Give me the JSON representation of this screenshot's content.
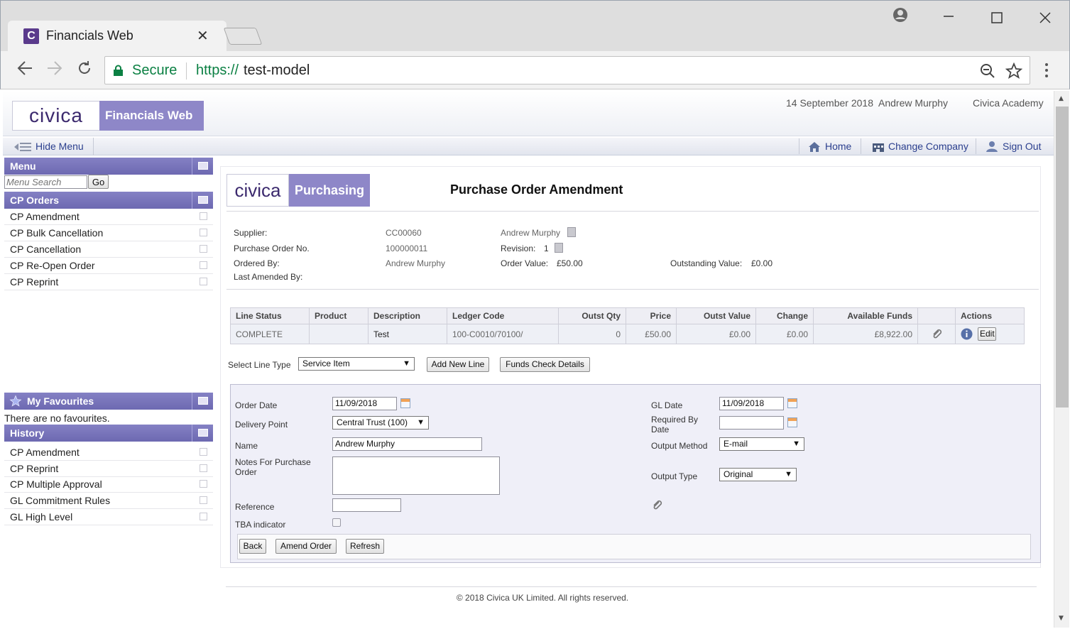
{
  "browser": {
    "tab_title": "Financials Web",
    "tab_icon": "C",
    "tab_close": "✕",
    "secure_label": "Secure",
    "url_scheme": "https://",
    "url_host": "test-model"
  },
  "header": {
    "logo_civica": "civica",
    "logo_product": "Financials Web",
    "date": "14 September 2018",
    "user": "Andrew Murphy",
    "organisation": "Civica Academy"
  },
  "menubar": {
    "hide_menu": "Hide Menu",
    "home": "Home",
    "change_company": "Change Company",
    "sign_out": "Sign Out"
  },
  "sidebar": {
    "menu_title": "Menu",
    "search_placeholder": "Menu Search",
    "go_label": "Go",
    "cp_orders_title": "CP Orders",
    "cp_orders_items": [
      "CP Amendment",
      "CP Bulk Cancellation",
      "CP Cancellation",
      "CP Re-Open Order",
      "CP Reprint"
    ],
    "favourites_title": "My Favourites",
    "favourites_empty": "There are no favourites.",
    "history_title": "History",
    "history_items": [
      "CP Amendment",
      "CP Reprint",
      "CP Multiple Approval",
      "GL Commitment Rules",
      "GL High Level"
    ]
  },
  "content": {
    "module_logo_civica": "civica",
    "module_logo_name": "Purchasing",
    "page_title": "Purchase Order Amendment",
    "summary": {
      "supplier_label": "Supplier:",
      "supplier_code": "CC00060",
      "supplier_name": "Andrew Murphy",
      "po_label": "Purchase Order No.",
      "po_number": "100000011",
      "revision_label": "Revision:",
      "revision_value": "1",
      "ordered_by_label": "Ordered By:",
      "ordered_by": "Andrew Murphy",
      "order_value_label": "Order Value:",
      "order_value": "£50.00",
      "outstanding_label": "Outstanding Value:",
      "outstanding_value": "£0.00",
      "last_amended_label": "Last Amended By:"
    },
    "lines_table": {
      "headers": [
        "Line Status",
        "Product",
        "Description",
        "Ledger Code",
        "Outst Qty",
        "Price",
        "Outst Value",
        "Change",
        "Available Funds",
        "",
        "Actions"
      ],
      "rows": [
        [
          "COMPLETE",
          "",
          "Test",
          "100-C0010/70100/",
          "0",
          "£50.00",
          "£0.00",
          "£0.00",
          "£8,922.00"
        ]
      ],
      "edit_label": "Edit"
    },
    "line_type": {
      "label": "Select Line Type",
      "value": "Service Item",
      "add_button": "Add New Line",
      "funds_button": "Funds Check Details"
    },
    "form": {
      "order_date_label": "Order Date",
      "order_date": "11/09/2018",
      "delivery_label": "Delivery Point",
      "delivery_value": "Central Trust (100)",
      "name_label": "Name",
      "name_value": "Andrew Murphy",
      "notes_label_1": "Notes For Purchase",
      "notes_label_2": "Order",
      "notes_value": "",
      "reference_label": "Reference",
      "reference_value": "",
      "tba_label": "TBA indicator",
      "gl_date_label": "GL Date",
      "gl_date": "11/09/2018",
      "required_label_1": "Required By",
      "required_label_2": "Date",
      "required_value": "",
      "output_method_label": "Output Method",
      "output_method": "E-mail",
      "output_type_label": "Output Type",
      "output_type": "Original",
      "back_button": "Back",
      "amend_button": "Amend Order",
      "refresh_button": "Refresh"
    },
    "footer": "© 2018 Civica UK Limited. All rights reserved."
  },
  "colors": {
    "accent_purple": "#8e87c8",
    "panel_header": "#6d69b1",
    "link_blue": "#2b3f8e",
    "secure_green": "#0b8043"
  }
}
